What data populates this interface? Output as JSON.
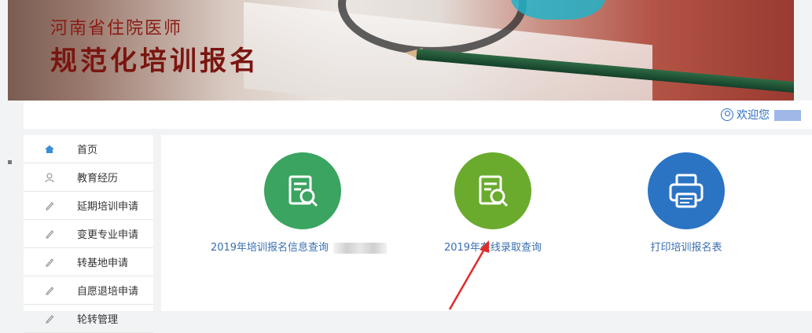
{
  "header": {
    "subtitle": "河南省住院医师",
    "title": "规范化培训报名"
  },
  "topbar": {
    "welcome_text": "欢迎您"
  },
  "sidebar": {
    "items": [
      {
        "label": "首页",
        "icon": "home-icon"
      },
      {
        "label": "教育经历",
        "icon": "user-icon"
      },
      {
        "label": "延期培训申请",
        "icon": "pencil-icon"
      },
      {
        "label": "变更专业申请",
        "icon": "pencil-icon"
      },
      {
        "label": "转基地申请",
        "icon": "pencil-icon"
      },
      {
        "label": "自愿退培申请",
        "icon": "pencil-icon"
      },
      {
        "label": "轮转管理",
        "icon": "pencil-icon"
      }
    ]
  },
  "main": {
    "tiles": [
      {
        "label": "2019年培训报名信息查询",
        "icon": "document-search-icon",
        "color": "#3aa460"
      },
      {
        "label": "2019年在线录取查询",
        "icon": "document-search-icon",
        "color": "#6aab2e"
      },
      {
        "label": "打印培训报名表",
        "icon": "printer-icon",
        "color": "#2b74c4"
      }
    ]
  },
  "colors": {
    "title_red": "#7a1510",
    "link_blue": "#2b6cc4",
    "arrow_red": "#e02b2b"
  }
}
